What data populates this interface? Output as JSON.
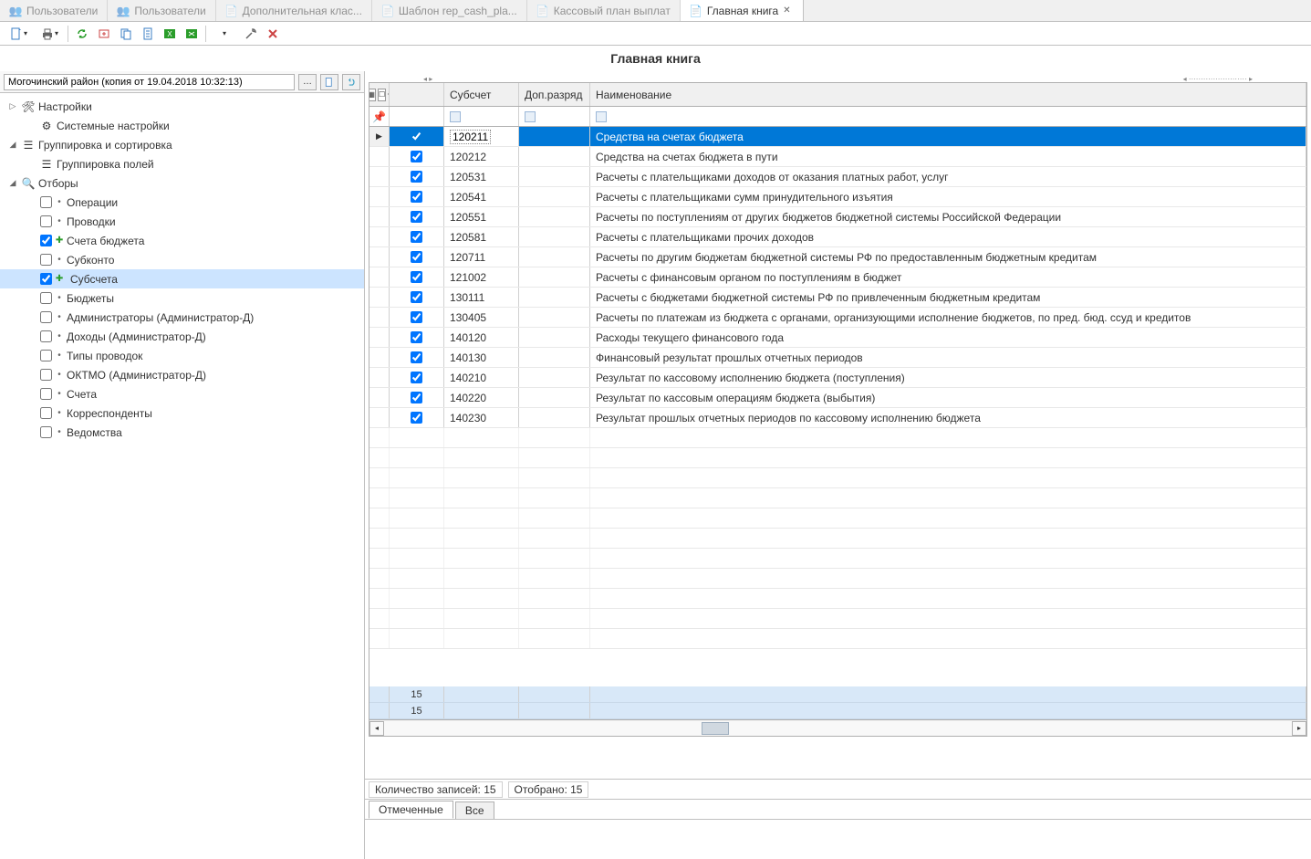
{
  "tabs": [
    {
      "label": "Пользователи",
      "icon": "users"
    },
    {
      "label": "Пользователи",
      "icon": "users"
    },
    {
      "label": "Дополнительная клас...",
      "icon": "form"
    },
    {
      "label": "Шаблон rep_cash_pla...",
      "icon": "form"
    },
    {
      "label": "Кассовый план выплат",
      "icon": "form"
    },
    {
      "label": "Главная книга",
      "icon": "form",
      "active": true
    }
  ],
  "page": {
    "title": "Главная книга"
  },
  "left": {
    "header_value": "Могочинский район (копия от 19.04.2018 10:32:13)",
    "nodes": [
      {
        "indent": 0,
        "toggle": "▷",
        "icon": "tools",
        "label": "Настройки"
      },
      {
        "indent": 1,
        "toggle": "",
        "icon": "gear",
        "label": "Системные настройки"
      },
      {
        "indent": 0,
        "toggle": "◢",
        "icon": "group",
        "label": "Группировка и сортировка"
      },
      {
        "indent": 1,
        "toggle": "",
        "icon": "group",
        "label": "Группировка полей"
      },
      {
        "indent": 0,
        "toggle": "◢",
        "icon": "filter",
        "label": "Отборы"
      },
      {
        "indent": 1,
        "toggle": "",
        "check": false,
        "bullet": "•",
        "label": "Операции"
      },
      {
        "indent": 1,
        "toggle": "",
        "check": false,
        "bullet": "•",
        "label": "Проводки"
      },
      {
        "indent": 1,
        "toggle": "",
        "check": true,
        "bullet": "✚",
        "bulletColor": "#2a9d2a",
        "label": "Счета бюджета"
      },
      {
        "indent": 1,
        "toggle": "",
        "check": false,
        "bullet": "•",
        "label": "Субконто"
      },
      {
        "indent": 1,
        "toggle": "",
        "check": true,
        "bullet": "✚",
        "bulletColor": "#2a9d2a",
        "label": "Субсчета",
        "selected": true
      },
      {
        "indent": 1,
        "toggle": "",
        "check": false,
        "bullet": "•",
        "label": "Бюджеты"
      },
      {
        "indent": 1,
        "toggle": "",
        "check": false,
        "bullet": "•",
        "label": "Администраторы (Администратор-Д)"
      },
      {
        "indent": 1,
        "toggle": "",
        "check": false,
        "bullet": "•",
        "label": "Доходы (Администратор-Д)"
      },
      {
        "indent": 1,
        "toggle": "",
        "check": false,
        "bullet": "•",
        "label": "Типы проводок"
      },
      {
        "indent": 1,
        "toggle": "",
        "check": false,
        "bullet": "•",
        "label": "ОКТМО (Администратор-Д)"
      },
      {
        "indent": 1,
        "toggle": "",
        "check": false,
        "bullet": "•",
        "label": "Счета"
      },
      {
        "indent": 1,
        "toggle": "",
        "check": false,
        "bullet": "•",
        "label": "Корреспонденты"
      },
      {
        "indent": 1,
        "toggle": "",
        "check": false,
        "bullet": "•",
        "label": "Ведомства"
      }
    ]
  },
  "grid": {
    "columns": {
      "sub": "Субсчет",
      "dop": "Доп.разряд",
      "name": "Наименование"
    },
    "rows": [
      {
        "checked": true,
        "sub": "120211",
        "dop": "",
        "name": "Средства на счетах бюджета",
        "selected": true
      },
      {
        "checked": true,
        "sub": "120212",
        "dop": "",
        "name": "Средства на счетах бюджета в пути"
      },
      {
        "checked": true,
        "sub": "120531",
        "dop": "",
        "name": "Расчеты с плательщиками доходов от оказания платных работ, услуг"
      },
      {
        "checked": true,
        "sub": "120541",
        "dop": "",
        "name": "Расчеты с плательщиками сумм принудительного изъятия"
      },
      {
        "checked": true,
        "sub": "120551",
        "dop": "",
        "name": "Расчеты по поступлениям от  других бюджетов бюджетной системы Российской Федерации"
      },
      {
        "checked": true,
        "sub": "120581",
        "dop": "",
        "name": "Расчеты с плательщиками прочих доходов"
      },
      {
        "checked": true,
        "sub": "120711",
        "dop": "",
        "name": "Расчеты по другим бюджетам бюджетной системы РФ по предоставленным бюджетным кредитам"
      },
      {
        "checked": true,
        "sub": "121002",
        "dop": "",
        "name": "Расчеты с финансовым органом по поступлениям в бюджет"
      },
      {
        "checked": true,
        "sub": "130111",
        "dop": "",
        "name": "Расчеты с бюджетами бюджетной системы РФ по привлеченным бюджетным кредитам"
      },
      {
        "checked": true,
        "sub": "130405",
        "dop": "",
        "name": "Расчеты по платежам из бюджета с органами, организующими исполнение бюджетов, по пред. бюд. ссуд и кредитов"
      },
      {
        "checked": true,
        "sub": "140120",
        "dop": "",
        "name": "Расходы текущего финансового года"
      },
      {
        "checked": true,
        "sub": "140130",
        "dop": "",
        "name": "Финансовый результат прошлых отчетных периодов"
      },
      {
        "checked": true,
        "sub": "140210",
        "dop": "",
        "name": "Результат по кассовому исполнению бюджета (поступления)"
      },
      {
        "checked": true,
        "sub": "140220",
        "dop": "",
        "name": "Результат по кассовым операциям бюджета (выбытия)"
      },
      {
        "checked": true,
        "sub": "140230",
        "dop": "",
        "name": "Результат прошлых отчетных периодов по кассовому исполнению бюджета"
      }
    ],
    "summary": [
      "15",
      "15"
    ]
  },
  "status": {
    "count_label": "Количество записей: 15",
    "selected_label": "Отобрано: 15"
  },
  "filter_tabs": {
    "marked": "Отмеченные",
    "all": "Все"
  }
}
